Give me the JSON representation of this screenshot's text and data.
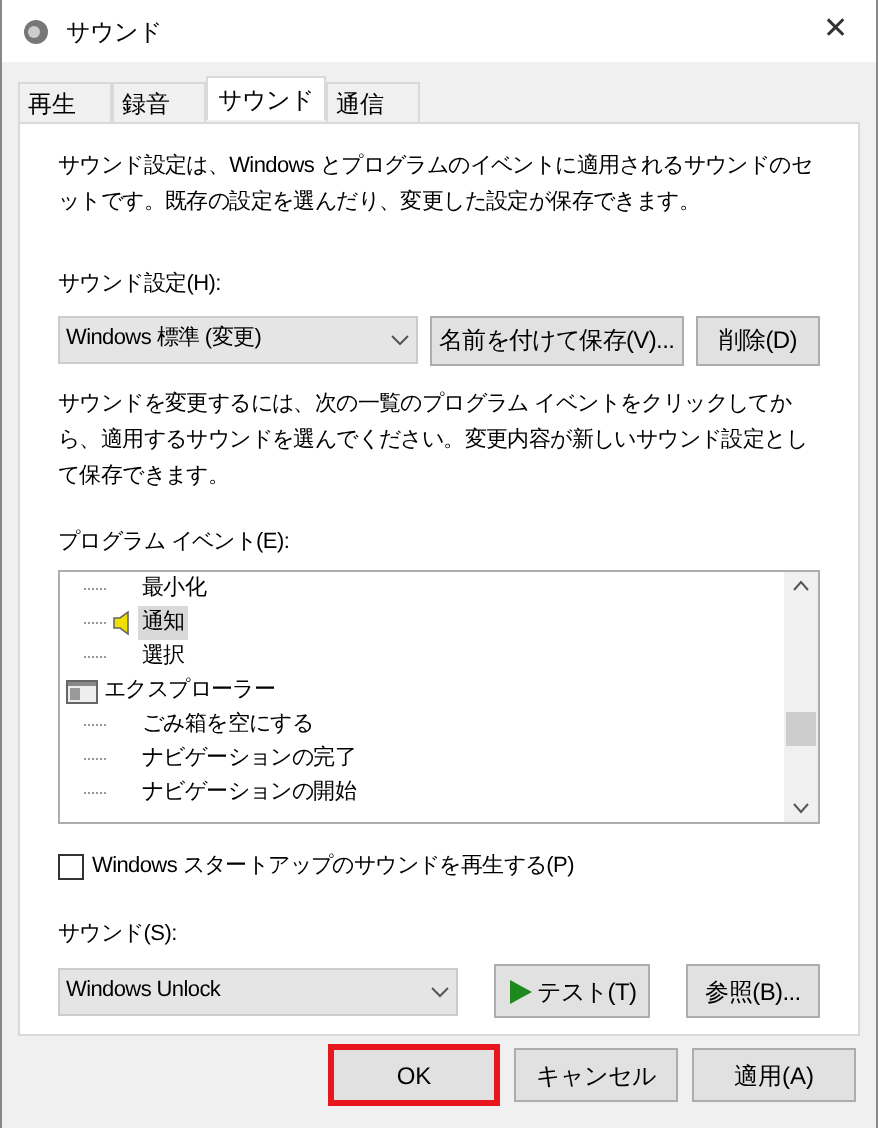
{
  "window": {
    "title": "サウンド",
    "close": "✕"
  },
  "tabs": [
    {
      "label": "再生",
      "selected": false
    },
    {
      "label": "録音",
      "selected": false
    },
    {
      "label": "サウンド",
      "selected": true
    },
    {
      "label": "通信",
      "selected": false
    }
  ],
  "intro": "サウンド設定は、Windows とプログラムのイベントに適用されるサウンドのセットです。既存の設定を選んだり、変更した設定が保存できます。",
  "scheme": {
    "label": "サウンド設定(H):",
    "value": "Windows 標準 (変更)",
    "buttons": [
      "名前を付けて保存(V)...",
      "削除(D)"
    ]
  },
  "instructions": "サウンドを変更するには、次の一覧のプログラム イベントをクリックしてから、適用するサウンドを選んでください。変更内容が新しいサウンド設定として保存できます。",
  "events": {
    "label": "プログラム イベント(E):",
    "groups": [
      {
        "children": [
          {
            "label": "最小化",
            "selected": false,
            "has_sound": false
          },
          {
            "label": "通知",
            "selected": true,
            "has_sound": true
          },
          {
            "label": "選択",
            "selected": false,
            "has_sound": false
          }
        ]
      },
      {
        "label": "エクスプローラー",
        "children": [
          {
            "label": "ごみ箱を空にする",
            "selected": false,
            "has_sound": false
          },
          {
            "label": "ナビゲーションの完了",
            "selected": false,
            "has_sound": false
          },
          {
            "label": "ナビゲーションの開始",
            "selected": false,
            "has_sound": false
          }
        ]
      }
    ]
  },
  "startup": {
    "label": "Windows スタートアップのサウンドを再生する(P)",
    "checked": false
  },
  "sound": {
    "label": "サウンド(S):",
    "value": "Windows Unlock",
    "test": "テスト(T)",
    "browse": "参照(B)..."
  },
  "footer": [
    {
      "label": "OK",
      "highlighted": true
    },
    {
      "label": "キャンセル",
      "highlighted": false
    },
    {
      "label": "適用(A)",
      "highlighted": false
    }
  ]
}
